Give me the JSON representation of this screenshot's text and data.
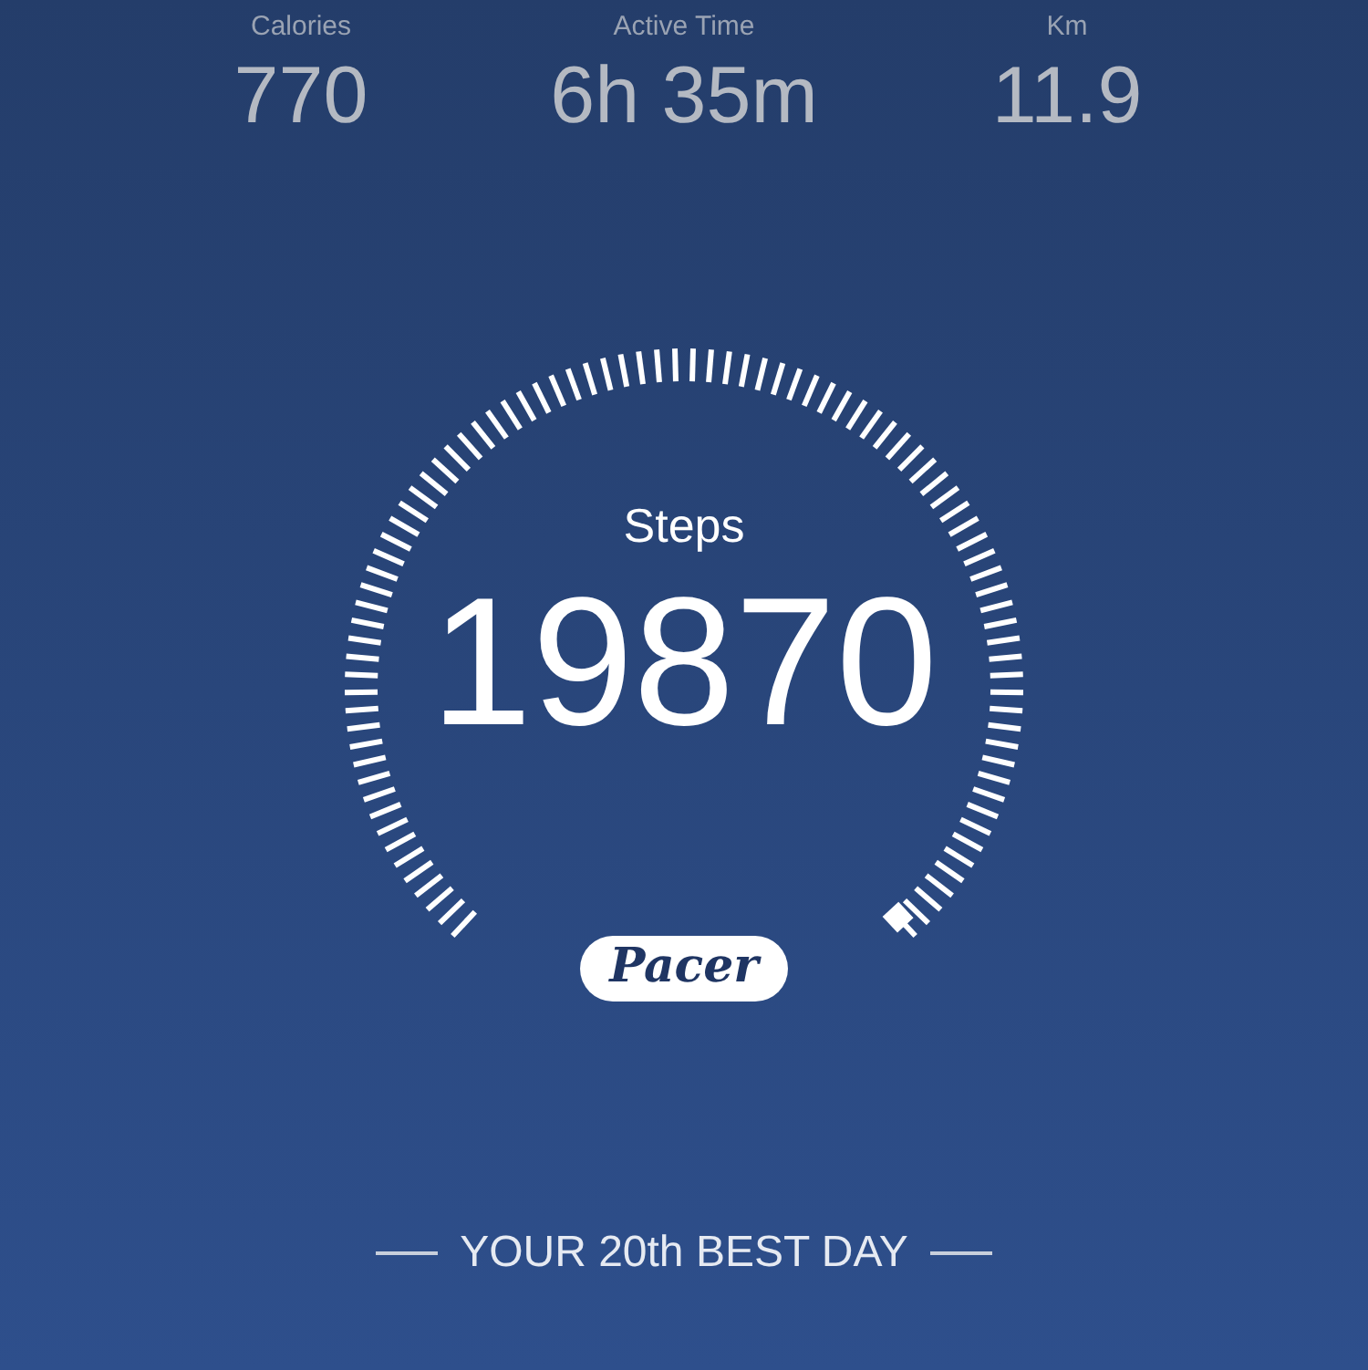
{
  "stats": [
    {
      "label": "Calories",
      "value": "770"
    },
    {
      "label": "Active Time",
      "value": "6h 35m"
    },
    {
      "label": "Km",
      "value": "11.9"
    }
  ],
  "gauge": {
    "label": "Steps",
    "value": "19870",
    "badge": "Pacer"
  },
  "rank": "YOUR 20th BEST DAY"
}
